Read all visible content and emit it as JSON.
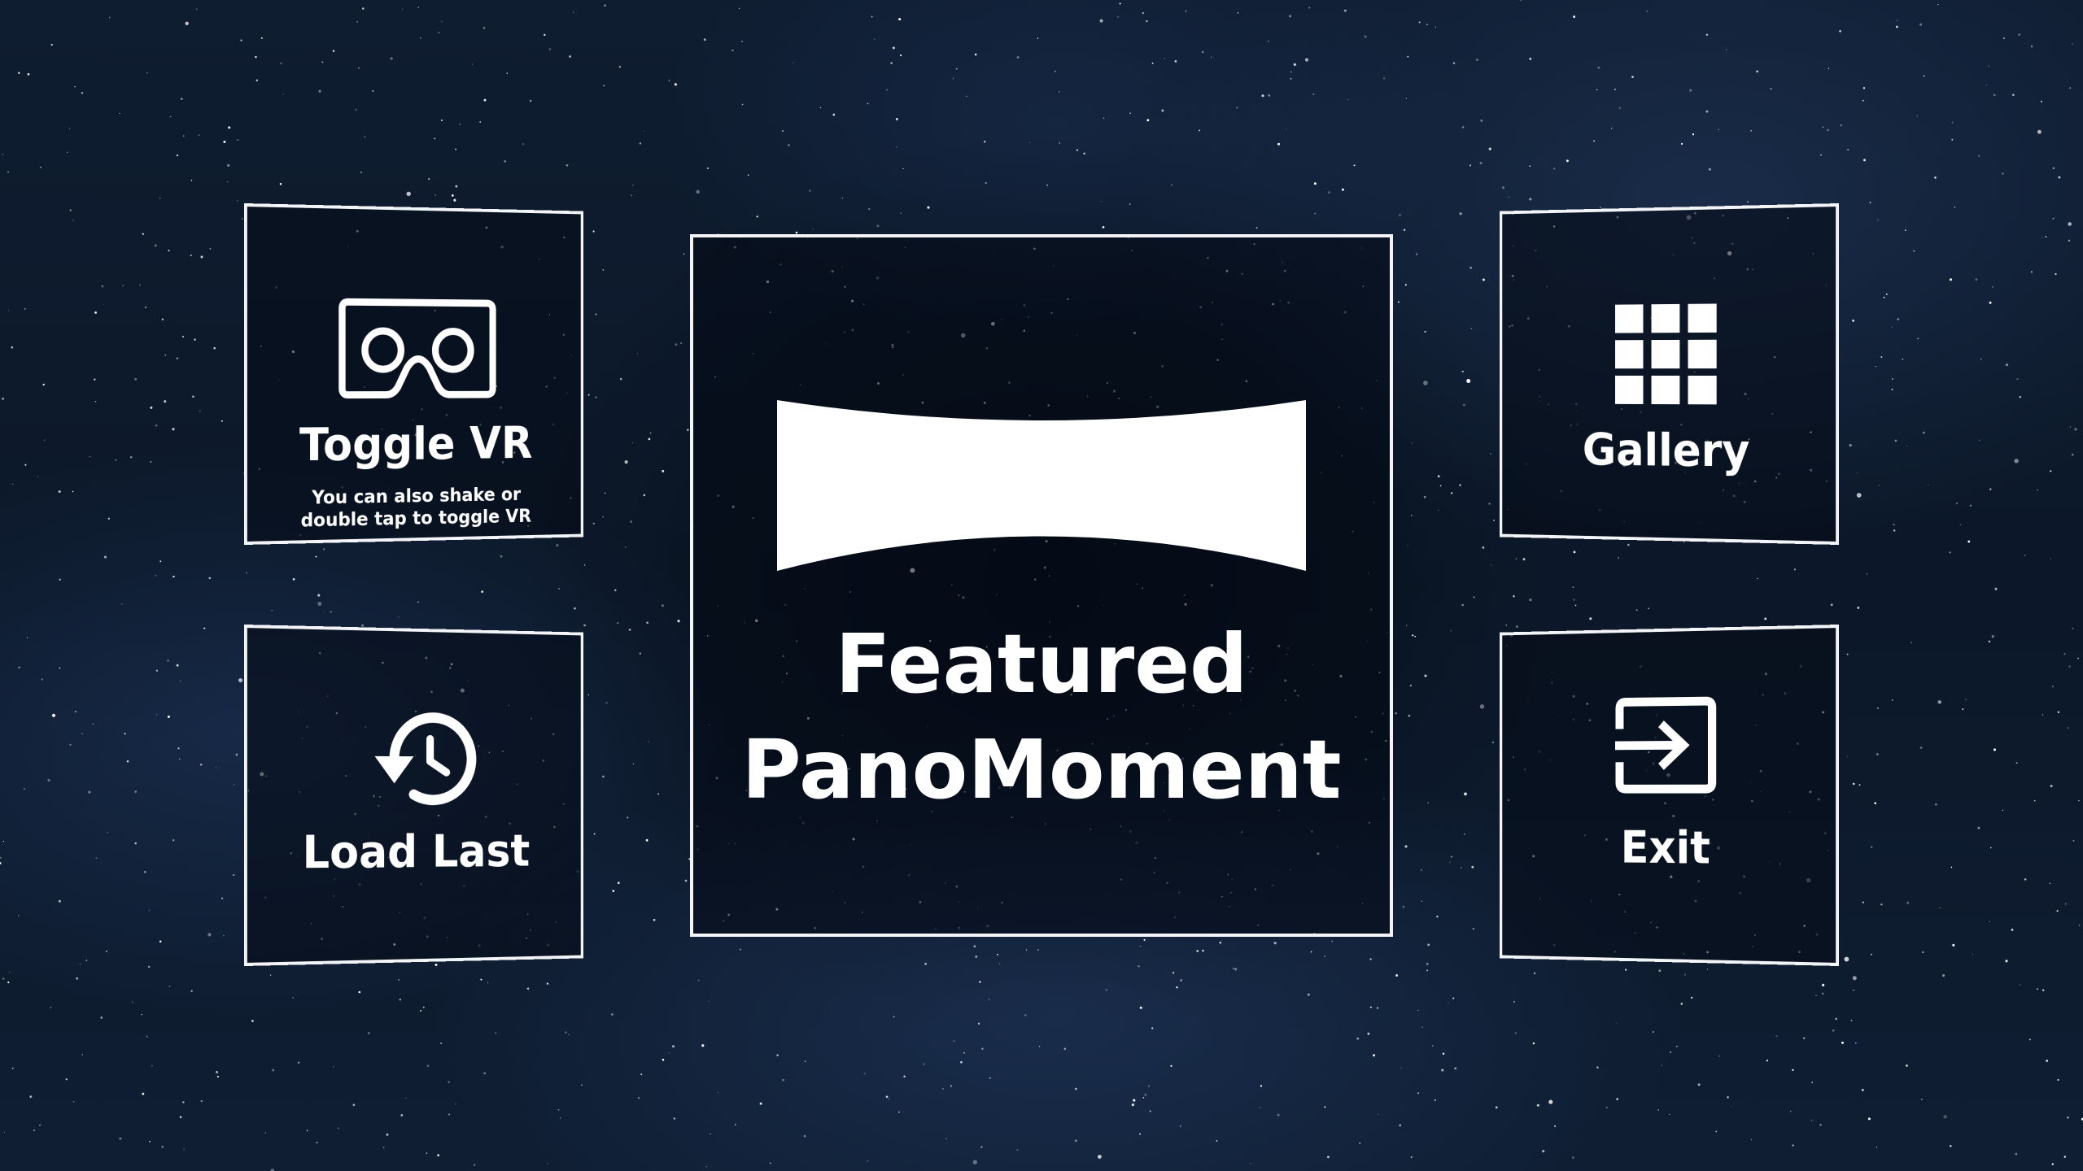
{
  "menu": {
    "toggle_vr": {
      "title": "Toggle VR",
      "subtitle": "You can also shake or double tap to toggle VR",
      "icon": "vr-headset-icon"
    },
    "load_last": {
      "title": "Load Last",
      "icon": "history-icon"
    },
    "featured": {
      "title_line1": "Featured",
      "title_line2": "PanoMoment",
      "icon": "panorama-icon"
    },
    "gallery": {
      "title": "Gallery",
      "icon": "grid-icon"
    },
    "exit": {
      "title": "Exit",
      "icon": "exit-icon"
    }
  },
  "colors": {
    "background": "#0c1829",
    "border": "#f2f4f7",
    "text": "#ffffff"
  }
}
